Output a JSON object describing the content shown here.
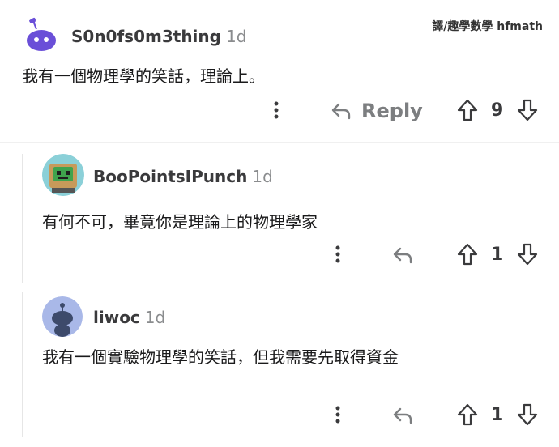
{
  "watermark": "譯/趣學數學 hfmath",
  "comments": [
    {
      "username": "S0n0fs0m3thing",
      "time": "1d",
      "text": "我有一個物理學的笑話，理論上。",
      "reply_label": "Reply",
      "votes": "9",
      "avatar_icon": "purple-snoo-avatar"
    },
    {
      "username": "BooPointsIPunch",
      "time": "1d",
      "text": "有何不可，畢竟你是理論上的物理學家",
      "votes": "1",
      "avatar_icon": "robot-box-avatar"
    },
    {
      "username": "liwoc",
      "time": "1d",
      "text": "我有一個實驗物理學的笑話，但我需要先取得資金",
      "votes": "1",
      "avatar_icon": "default-snoo-avatar"
    }
  ],
  "colors": {
    "accent_purple": "#6a4fd8",
    "icon_gray": "#7c7e80",
    "text": "#1a1a1b"
  }
}
